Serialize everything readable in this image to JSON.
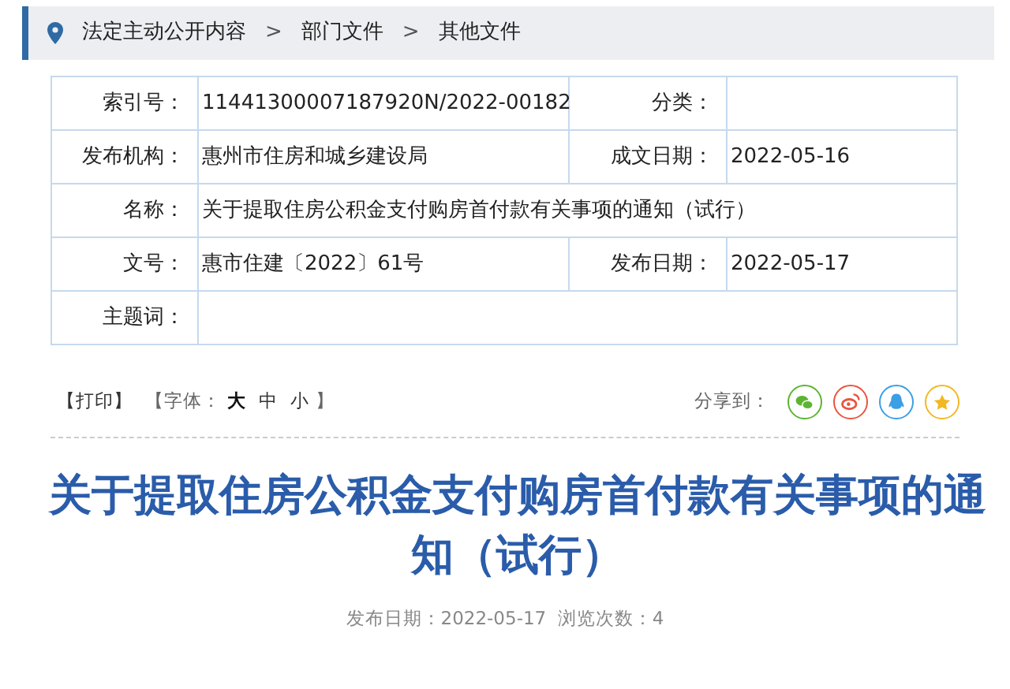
{
  "breadcrumb": [
    "法定主动公开内容",
    "部门文件",
    "其他文件"
  ],
  "breadcrumb_separator": ">",
  "info_table": [
    {
      "kind": "pair",
      "cells": [
        {
          "label": "索引号：",
          "value": "11441300007187920N/2022-00182"
        },
        {
          "label": "分类："
        }
      ]
    },
    {
      "kind": "pair",
      "cells": [
        {
          "label": "发布机构：",
          "value": "惠州市住房和城乡建设局"
        },
        {
          "label": "成文日期：",
          "value": "2022-05-16"
        }
      ]
    },
    {
      "kind": "full",
      "cells": [
        {
          "label": "名称：",
          "value": "关于提取住房公积金支付购房首付款有关事项的通知（试行）"
        }
      ]
    },
    {
      "kind": "pair",
      "cells": [
        {
          "label": "文号：",
          "value": "惠市住建〔2022〕61号"
        },
        {
          "label": "发布日期：",
          "value": "2022-05-17"
        }
      ]
    },
    {
      "kind": "full",
      "cells": [
        {
          "label": "主题词："
        }
      ]
    }
  ],
  "toolbar": {
    "print": "【打印】",
    "font_label": "【字体：",
    "font_sizes": [
      {
        "label": "大",
        "selected": true
      },
      {
        "label": "中",
        "selected": false
      },
      {
        "label": "小",
        "selected": false
      }
    ],
    "font_end": "】",
    "share_label": "分享到：",
    "share": [
      {
        "kind": "wechat",
        "color": "#5cb531"
      },
      {
        "kind": "weibo",
        "color": "#e8553f"
      },
      {
        "kind": "qq",
        "color": "#3c9ee5"
      },
      {
        "kind": "favorite",
        "color": "#f2b824"
      }
    ]
  },
  "article": {
    "title": "关于提取住房公积金支付购房首付款有关事项的通知（试行）",
    "meta": "发布日期：2022-05-17  浏览次数：4"
  }
}
